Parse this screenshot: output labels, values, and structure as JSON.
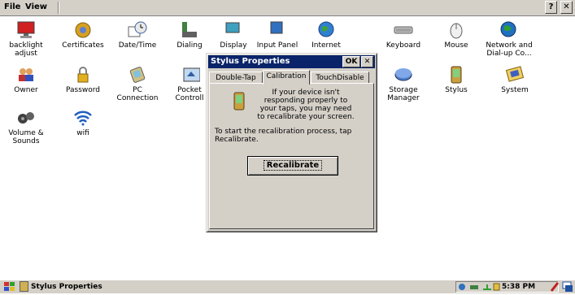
{
  "menu": {
    "file": "File",
    "view": "View",
    "help": "?",
    "close": "✕"
  },
  "desktop": {
    "row1": [
      "backlight adjust",
      "Certificates",
      "Date/Time",
      "Dialing",
      "Display",
      "Input Panel",
      "Internet",
      "Keyboard",
      "Mouse",
      "Network and Dial-up Co..."
    ],
    "row2": [
      "Owner",
      "Password",
      "PC Connection",
      "Pocket Controll",
      "Storage Manager",
      "Stylus",
      "System"
    ],
    "row3": [
      "Volume & Sounds",
      "wifi"
    ]
  },
  "dialog": {
    "title": "Stylus Properties",
    "ok": "OK",
    "close": "✕",
    "tabs": [
      "Double-Tap",
      "Calibration",
      "TouchDisable"
    ],
    "active_tab": "Calibration",
    "text1": "If your device isn't responding properly to your taps, you may need to recalibrate your screen.",
    "text2": "To start the recalibration process, tap Recalibrate.",
    "button": "Recalibrate"
  },
  "taskbar": {
    "task": "Stylus Properties",
    "clock": "5:38 PM"
  },
  "colors": {
    "titlebar": "#0a246a",
    "chrome": "#d4d0c8",
    "desktop": "#ffffff"
  }
}
